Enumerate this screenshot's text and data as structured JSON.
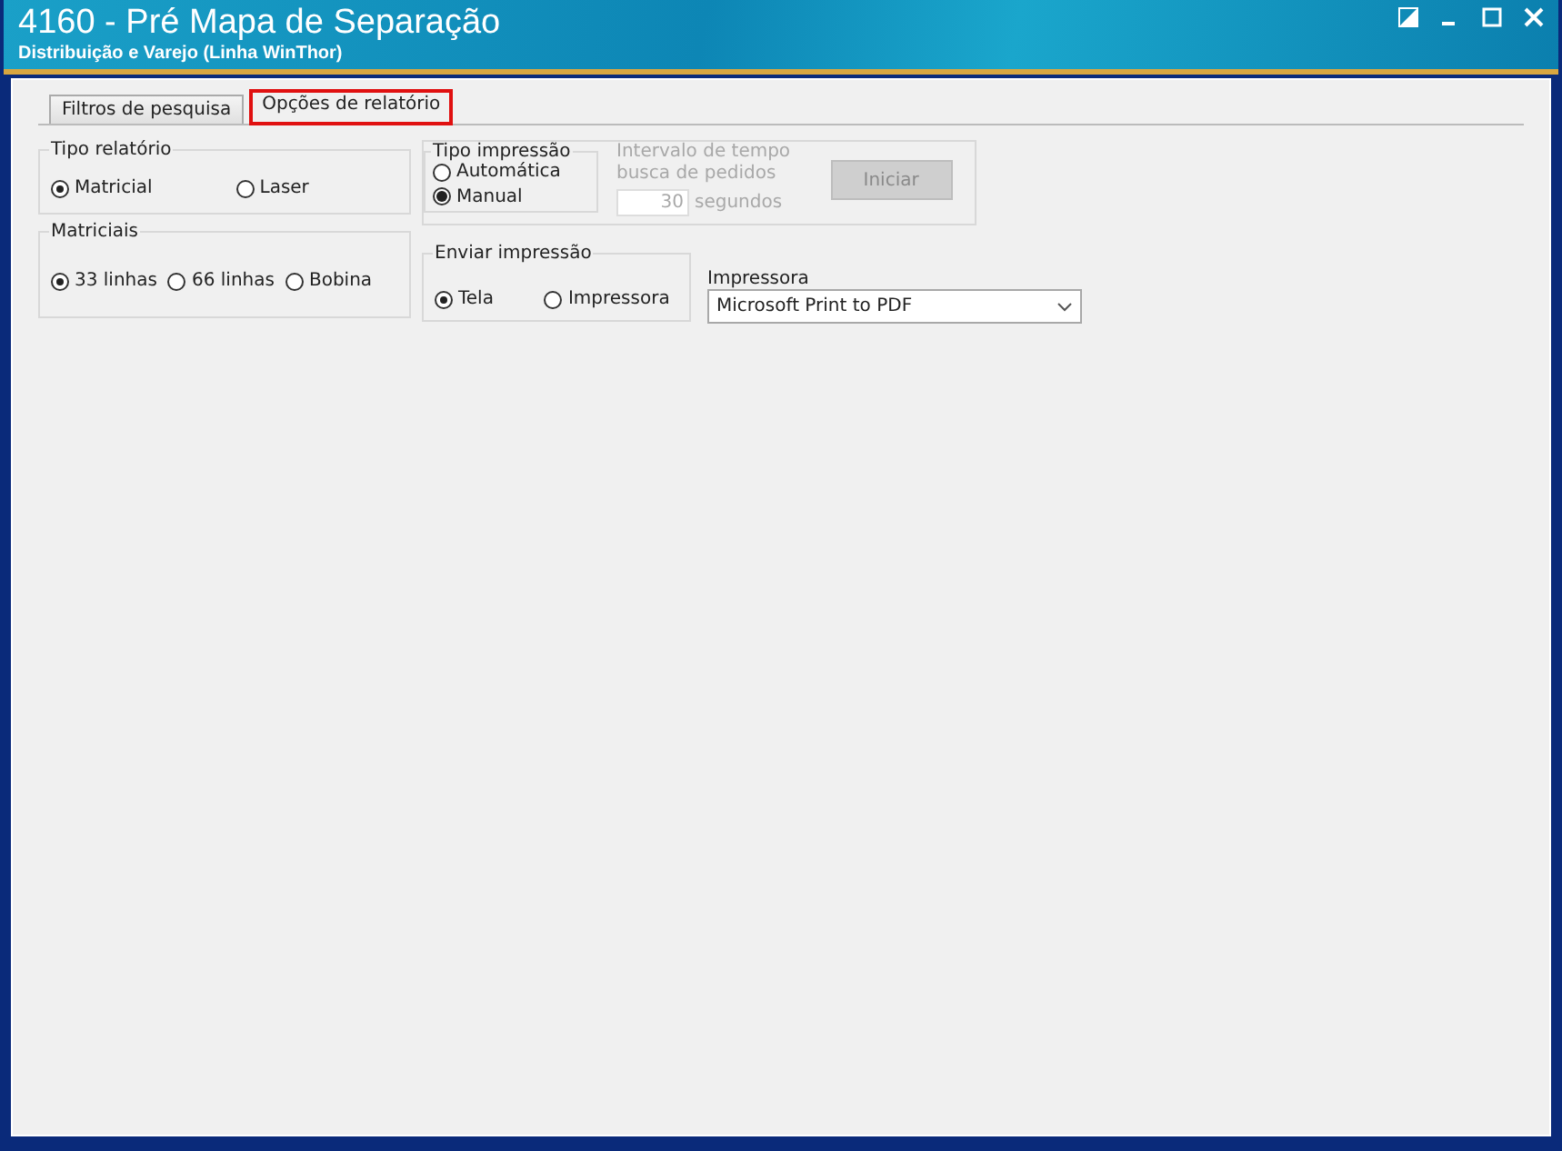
{
  "window": {
    "title": "4160 - Pré Mapa de Separação",
    "subtitle": "Distribuição e Varejo (Linha WinThor)"
  },
  "tabs": [
    {
      "label": "Filtros de pesquisa",
      "selected": false,
      "highlighted": false
    },
    {
      "label": "Opções de relatório",
      "selected": true,
      "highlighted": true
    }
  ],
  "tipo_relatorio": {
    "title": "Tipo relatório",
    "options": [
      {
        "label": "Matricial",
        "selected": true
      },
      {
        "label": "Laser",
        "selected": false
      }
    ]
  },
  "matriciais": {
    "title": "Matriciais",
    "options": [
      {
        "label": "33 linhas",
        "selected": true
      },
      {
        "label": "66 linhas",
        "selected": false
      },
      {
        "label": "Bobina",
        "selected": false
      }
    ]
  },
  "tipo_impressao": {
    "title": "Tipo impressão",
    "options": [
      {
        "label": "Automática",
        "selected": false
      },
      {
        "label": "Manual",
        "selected": true
      }
    ]
  },
  "intervalo": {
    "label_1": "Intervalo de tempo",
    "label_2": "busca de pedidos",
    "value": "30",
    "unit": "segundos",
    "disabled": true
  },
  "iniciar_button": {
    "label": "Iniciar",
    "disabled": true
  },
  "enviar_impressao": {
    "title": "Enviar impressão",
    "options": [
      {
        "label": "Tela",
        "selected": true
      },
      {
        "label": "Impressora",
        "selected": false
      }
    ]
  },
  "impressora": {
    "label": "Impressora",
    "value": "Microsoft Print to PDF"
  }
}
